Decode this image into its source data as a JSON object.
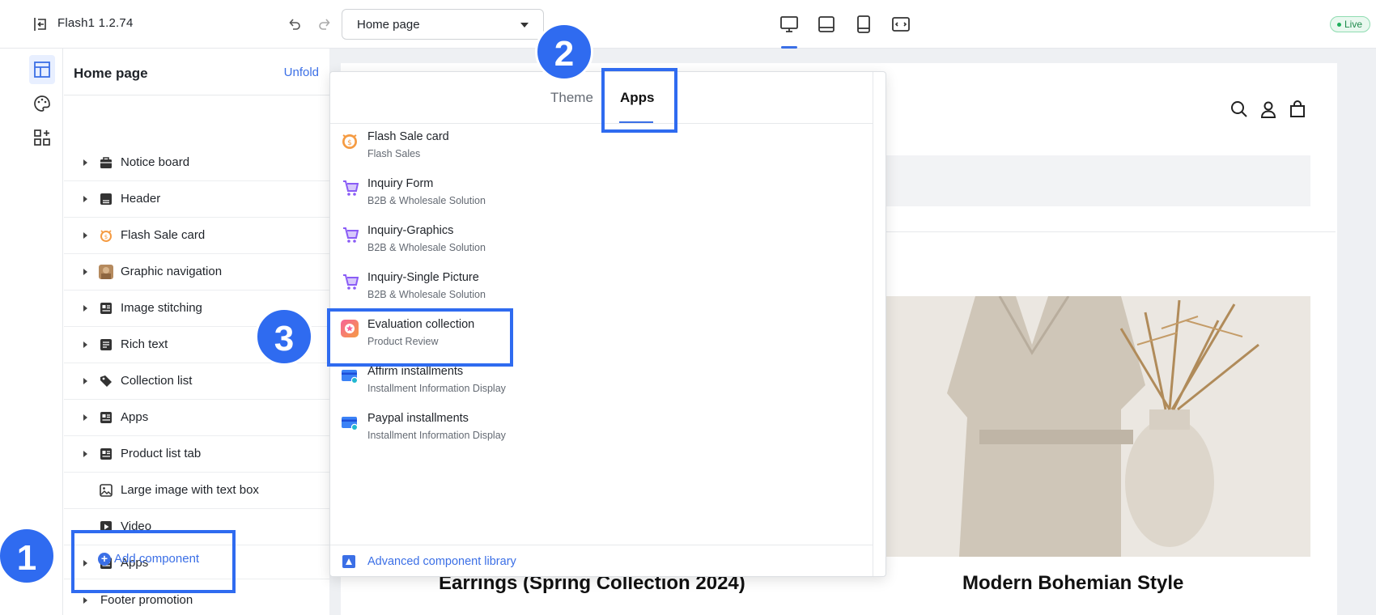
{
  "topbar": {
    "app_title": "Flash1  1.2.74",
    "page_select_value": "Home page",
    "live_label": "Live"
  },
  "outline": {
    "title": "Home page",
    "unfold_label": "Unfold",
    "items": [
      {
        "label": "Notice board",
        "icon": "notice-icon",
        "expandable": true
      },
      {
        "label": "Header",
        "icon": "header-icon",
        "expandable": true
      },
      {
        "label": "Flash Sale card",
        "icon": "flash-sale-icon",
        "expandable": true
      },
      {
        "label": "Graphic navigation",
        "icon": "graphic-thumb",
        "expandable": true
      },
      {
        "label": "Image stitching",
        "icon": "image-stitching-icon",
        "expandable": true
      },
      {
        "label": "Rich text",
        "icon": "rich-text-icon",
        "expandable": true
      },
      {
        "label": "Collection list",
        "icon": "collection-icon",
        "expandable": true
      },
      {
        "label": "Apps",
        "icon": "apps-icon",
        "expandable": true
      },
      {
        "label": "Product list tab",
        "icon": "product-list-icon",
        "expandable": true
      },
      {
        "label": "Large image with text box",
        "icon": "large-image-icon",
        "expandable": false
      },
      {
        "label": "Video",
        "icon": "video-icon",
        "expandable": false
      },
      {
        "label": "Apps",
        "icon": "apps-icon",
        "expandable": true
      }
    ],
    "add_component_label": "Add component",
    "footer_item_label": "Footer promotion"
  },
  "picker": {
    "tab_theme": "Theme",
    "tab_apps": "Apps",
    "items": [
      {
        "name": "Flash Sale card",
        "sub": "Flash Sales",
        "icon": "flash-sale-icon"
      },
      {
        "name": "Inquiry Form",
        "sub": "B2B & Wholesale Solution",
        "icon": "inquiry-icon"
      },
      {
        "name": "Inquiry-Graphics",
        "sub": "B2B & Wholesale Solution",
        "icon": "inquiry-icon"
      },
      {
        "name": "Inquiry-Single Picture",
        "sub": "B2B & Wholesale Solution",
        "icon": "inquiry-icon"
      },
      {
        "name": "Evaluation collection",
        "sub": "Product Review",
        "icon": "review-icon"
      },
      {
        "name": "Affirm installments",
        "sub": "Installment Information Display",
        "icon": "card-icon"
      },
      {
        "name": "Paypal installments",
        "sub": "Installment Information Display",
        "icon": "card-icon"
      }
    ],
    "footer_label": "Advanced component library"
  },
  "preview": {
    "caption_left": "Earrings (Spring Collection 2024)",
    "caption_right": "Modern Bohemian Style"
  },
  "steps": {
    "one": "1",
    "two": "2",
    "three": "3"
  },
  "colors": {
    "accent": "#3b6fe6",
    "highlight": "#2f6bf0",
    "live": "#1fae5b"
  }
}
